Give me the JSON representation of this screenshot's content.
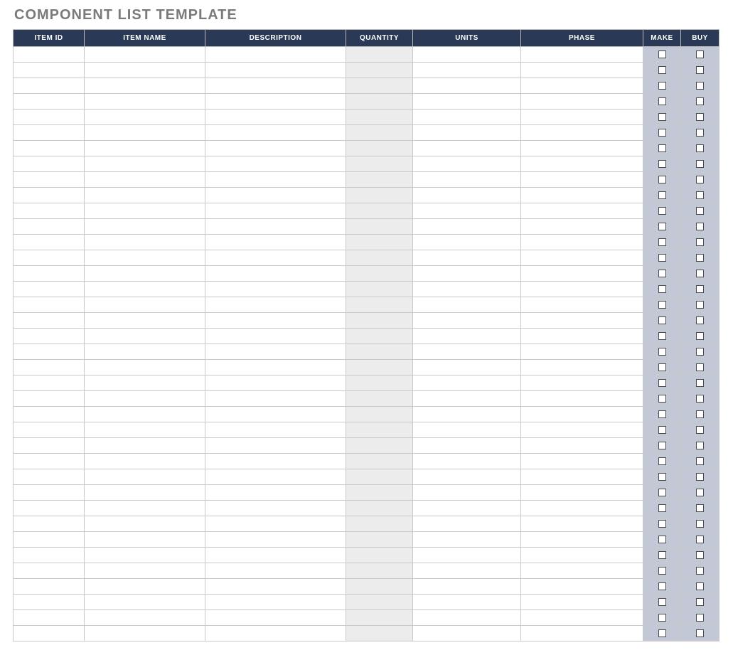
{
  "title": "COMPONENT LIST TEMPLATE",
  "columns": {
    "item_id": "ITEM ID",
    "item_name": "ITEM NAME",
    "description": "DESCRIPTION",
    "quantity": "QUANTITY",
    "units": "UNITS",
    "phase": "PHASE",
    "make": "MAKE",
    "buy": "BUY"
  },
  "rows": [
    {
      "item_id": "",
      "item_name": "",
      "description": "",
      "quantity": "",
      "units": "",
      "phase": "",
      "make": false,
      "buy": false
    },
    {
      "item_id": "",
      "item_name": "",
      "description": "",
      "quantity": "",
      "units": "",
      "phase": "",
      "make": false,
      "buy": false
    },
    {
      "item_id": "",
      "item_name": "",
      "description": "",
      "quantity": "",
      "units": "",
      "phase": "",
      "make": false,
      "buy": false
    },
    {
      "item_id": "",
      "item_name": "",
      "description": "",
      "quantity": "",
      "units": "",
      "phase": "",
      "make": false,
      "buy": false
    },
    {
      "item_id": "",
      "item_name": "",
      "description": "",
      "quantity": "",
      "units": "",
      "phase": "",
      "make": false,
      "buy": false
    },
    {
      "item_id": "",
      "item_name": "",
      "description": "",
      "quantity": "",
      "units": "",
      "phase": "",
      "make": false,
      "buy": false
    },
    {
      "item_id": "",
      "item_name": "",
      "description": "",
      "quantity": "",
      "units": "",
      "phase": "",
      "make": false,
      "buy": false
    },
    {
      "item_id": "",
      "item_name": "",
      "description": "",
      "quantity": "",
      "units": "",
      "phase": "",
      "make": false,
      "buy": false
    },
    {
      "item_id": "",
      "item_name": "",
      "description": "",
      "quantity": "",
      "units": "",
      "phase": "",
      "make": false,
      "buy": false
    },
    {
      "item_id": "",
      "item_name": "",
      "description": "",
      "quantity": "",
      "units": "",
      "phase": "",
      "make": false,
      "buy": false
    },
    {
      "item_id": "",
      "item_name": "",
      "description": "",
      "quantity": "",
      "units": "",
      "phase": "",
      "make": false,
      "buy": false
    },
    {
      "item_id": "",
      "item_name": "",
      "description": "",
      "quantity": "",
      "units": "",
      "phase": "",
      "make": false,
      "buy": false
    },
    {
      "item_id": "",
      "item_name": "",
      "description": "",
      "quantity": "",
      "units": "",
      "phase": "",
      "make": false,
      "buy": false
    },
    {
      "item_id": "",
      "item_name": "",
      "description": "",
      "quantity": "",
      "units": "",
      "phase": "",
      "make": false,
      "buy": false
    },
    {
      "item_id": "",
      "item_name": "",
      "description": "",
      "quantity": "",
      "units": "",
      "phase": "",
      "make": false,
      "buy": false
    },
    {
      "item_id": "",
      "item_name": "",
      "description": "",
      "quantity": "",
      "units": "",
      "phase": "",
      "make": false,
      "buy": false
    },
    {
      "item_id": "",
      "item_name": "",
      "description": "",
      "quantity": "",
      "units": "",
      "phase": "",
      "make": false,
      "buy": false
    },
    {
      "item_id": "",
      "item_name": "",
      "description": "",
      "quantity": "",
      "units": "",
      "phase": "",
      "make": false,
      "buy": false
    },
    {
      "item_id": "",
      "item_name": "",
      "description": "",
      "quantity": "",
      "units": "",
      "phase": "",
      "make": false,
      "buy": false
    },
    {
      "item_id": "",
      "item_name": "",
      "description": "",
      "quantity": "",
      "units": "",
      "phase": "",
      "make": false,
      "buy": false
    },
    {
      "item_id": "",
      "item_name": "",
      "description": "",
      "quantity": "",
      "units": "",
      "phase": "",
      "make": false,
      "buy": false
    },
    {
      "item_id": "",
      "item_name": "",
      "description": "",
      "quantity": "",
      "units": "",
      "phase": "",
      "make": false,
      "buy": false
    },
    {
      "item_id": "",
      "item_name": "",
      "description": "",
      "quantity": "",
      "units": "",
      "phase": "",
      "make": false,
      "buy": false
    },
    {
      "item_id": "",
      "item_name": "",
      "description": "",
      "quantity": "",
      "units": "",
      "phase": "",
      "make": false,
      "buy": false
    },
    {
      "item_id": "",
      "item_name": "",
      "description": "",
      "quantity": "",
      "units": "",
      "phase": "",
      "make": false,
      "buy": false
    },
    {
      "item_id": "",
      "item_name": "",
      "description": "",
      "quantity": "",
      "units": "",
      "phase": "",
      "make": false,
      "buy": false
    },
    {
      "item_id": "",
      "item_name": "",
      "description": "",
      "quantity": "",
      "units": "",
      "phase": "",
      "make": false,
      "buy": false
    },
    {
      "item_id": "",
      "item_name": "",
      "description": "",
      "quantity": "",
      "units": "",
      "phase": "",
      "make": false,
      "buy": false
    },
    {
      "item_id": "",
      "item_name": "",
      "description": "",
      "quantity": "",
      "units": "",
      "phase": "",
      "make": false,
      "buy": false
    },
    {
      "item_id": "",
      "item_name": "",
      "description": "",
      "quantity": "",
      "units": "",
      "phase": "",
      "make": false,
      "buy": false
    },
    {
      "item_id": "",
      "item_name": "",
      "description": "",
      "quantity": "",
      "units": "",
      "phase": "",
      "make": false,
      "buy": false
    },
    {
      "item_id": "",
      "item_name": "",
      "description": "",
      "quantity": "",
      "units": "",
      "phase": "",
      "make": false,
      "buy": false
    },
    {
      "item_id": "",
      "item_name": "",
      "description": "",
      "quantity": "",
      "units": "",
      "phase": "",
      "make": false,
      "buy": false
    },
    {
      "item_id": "",
      "item_name": "",
      "description": "",
      "quantity": "",
      "units": "",
      "phase": "",
      "make": false,
      "buy": false
    },
    {
      "item_id": "",
      "item_name": "",
      "description": "",
      "quantity": "",
      "units": "",
      "phase": "",
      "make": false,
      "buy": false
    },
    {
      "item_id": "",
      "item_name": "",
      "description": "",
      "quantity": "",
      "units": "",
      "phase": "",
      "make": false,
      "buy": false
    },
    {
      "item_id": "",
      "item_name": "",
      "description": "",
      "quantity": "",
      "units": "",
      "phase": "",
      "make": false,
      "buy": false
    },
    {
      "item_id": "",
      "item_name": "",
      "description": "",
      "quantity": "",
      "units": "",
      "phase": "",
      "make": false,
      "buy": false
    }
  ]
}
